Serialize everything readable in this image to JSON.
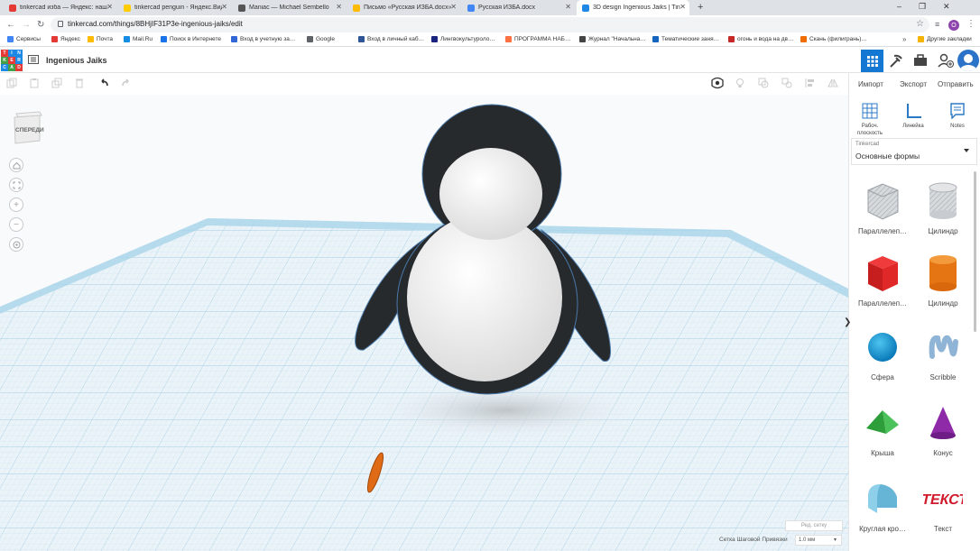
{
  "browser": {
    "tabs": [
      {
        "label": "tinkercad изба — Яндекс: нашл…",
        "icon": "yandex-icon",
        "color": "#e53935"
      },
      {
        "label": "tinkercad penguin - Яндекс.Виде…",
        "icon": "yandex-video-icon",
        "color": "#ffcc00"
      },
      {
        "label": "Maniac — Michael Sembello",
        "icon": "play-icon",
        "color": "#555555"
      },
      {
        "label": "Письмо «Русская ИЗБА.docx» —",
        "icon": "mail-icon",
        "color": "#ffbb00"
      },
      {
        "label": "Русская ИЗБА.docx",
        "icon": "doc-icon",
        "color": "#4285f4"
      },
      {
        "label": "3D design Ingenious Jaiks | Tinke…",
        "icon": "tinkercad-tab-icon",
        "color": "#1e88e5"
      }
    ],
    "url": "tinkercad.com/things/8BHjIF31P3e-ingenious-jaiks/edit",
    "bookmarks": [
      {
        "label": "Сервисы",
        "color": "#4285f4"
      },
      {
        "label": "Яндекс",
        "color": "#e53935"
      },
      {
        "label": "Почта",
        "color": "#ffbb00"
      },
      {
        "label": "Mail.Ru",
        "color": "#168de2"
      },
      {
        "label": "Поиск в Интернете",
        "color": "#1a73e8"
      },
      {
        "label": "Вход в учетную за…",
        "color": "#3367d6"
      },
      {
        "label": "Google",
        "color": "#5f6368"
      },
      {
        "label": "Вход в личный каб…",
        "color": "#2f5597"
      },
      {
        "label": "Лингвокультуроло…",
        "color": "#1a237e"
      },
      {
        "label": "ПРОГРАММА НАБ…",
        "color": "#ff7043"
      },
      {
        "label": "Журнал \"Начальна…",
        "color": "#444444"
      },
      {
        "label": "Тематические заня…",
        "color": "#1565c0"
      },
      {
        "label": "огонь и вода на дв…",
        "color": "#c62828"
      },
      {
        "label": "Скань (филигрань)…",
        "color": "#ef6c00"
      }
    ],
    "other_bookmarks": "Другие закладки",
    "profile_initial": "O"
  },
  "app": {
    "logo_letters": [
      "T",
      "I",
      "N",
      "K",
      "E",
      "R",
      "C",
      "A",
      "D"
    ],
    "design_title": "Ingenious Jaiks",
    "actions": {
      "import": "Импорт",
      "export": "Экспорт",
      "send": "Отправить"
    },
    "panel_tools": {
      "workplane": "Рабоч. плоскость",
      "ruler": "Линейка",
      "notes": "Notes"
    },
    "library": {
      "source": "Tinkercad",
      "category": "Основные формы"
    },
    "shapes": [
      {
        "label": "Параллелеп…",
        "kind": "box-hole"
      },
      {
        "label": "Цилиндр",
        "kind": "cylinder-hole"
      },
      {
        "label": "Параллелеп…",
        "kind": "box"
      },
      {
        "label": "Цилиндр",
        "kind": "cylinder"
      },
      {
        "label": "Сфера",
        "kind": "sphere"
      },
      {
        "label": "Scribble",
        "kind": "scribble"
      },
      {
        "label": "Крыша",
        "kind": "roof"
      },
      {
        "label": "Конус",
        "kind": "cone"
      },
      {
        "label": "Круглая кро…",
        "kind": "round-roof"
      },
      {
        "label": "Текст",
        "kind": "text"
      }
    ],
    "viewcube_label": "СПЕРЕДИ",
    "edit_grid": "Ред. сетку",
    "snap_label": "Сетка Шаговой Привязки",
    "snap_value": "1.0 мм"
  }
}
